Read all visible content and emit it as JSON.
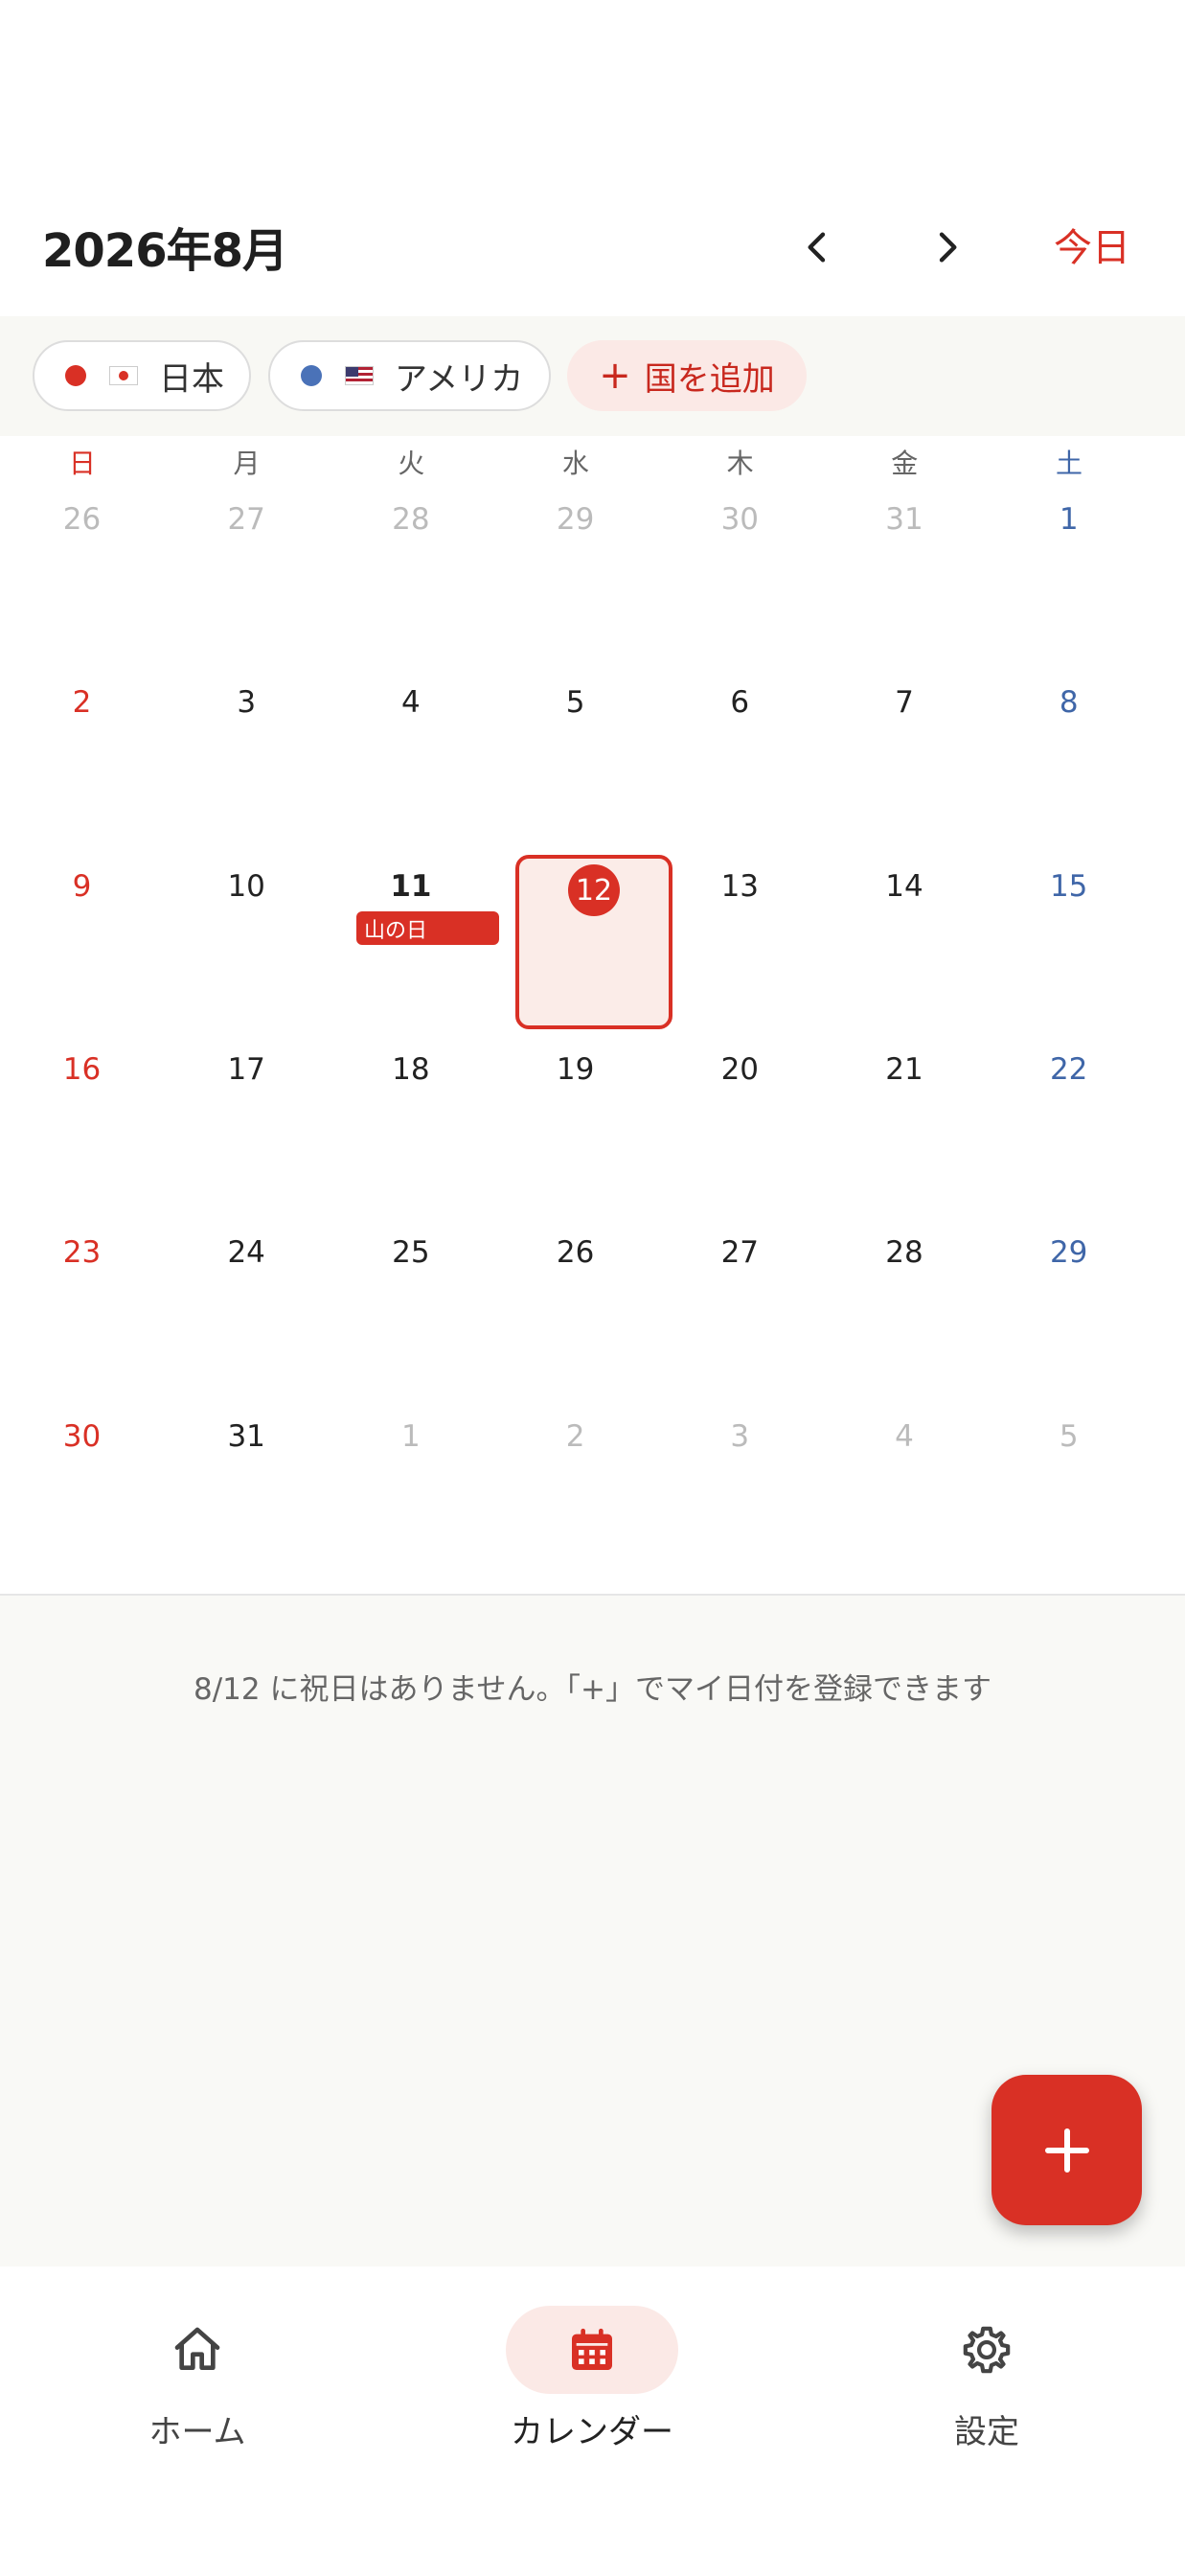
{
  "header": {
    "month_title": "2026年8月",
    "today_label": "今日"
  },
  "filters": {
    "chips": [
      {
        "label": "日本",
        "dot_color": "#d93025",
        "flag": "jp-flag"
      },
      {
        "label": "アメリカ",
        "dot_color": "#4a72b8",
        "flag": "us-flag"
      }
    ],
    "add_label": "国を追加"
  },
  "weekdays": [
    "日",
    "月",
    "火",
    "水",
    "木",
    "金",
    "土"
  ],
  "weeks": [
    [
      {
        "d": "26",
        "m": true
      },
      {
        "d": "27",
        "m": true
      },
      {
        "d": "28",
        "m": true
      },
      {
        "d": "29",
        "m": true
      },
      {
        "d": "30",
        "m": true
      },
      {
        "d": "31",
        "m": true
      },
      {
        "d": "1",
        "m": false
      }
    ],
    [
      {
        "d": "2",
        "m": false
      },
      {
        "d": "3",
        "m": false
      },
      {
        "d": "4",
        "m": false
      },
      {
        "d": "5",
        "m": false
      },
      {
        "d": "6",
        "m": false
      },
      {
        "d": "7",
        "m": false
      },
      {
        "d": "8",
        "m": false
      }
    ],
    [
      {
        "d": "9",
        "m": false
      },
      {
        "d": "10",
        "m": false
      },
      {
        "d": "11",
        "m": false,
        "holiday": true
      },
      {
        "d": "12",
        "m": false,
        "selected": true
      },
      {
        "d": "13",
        "m": false
      },
      {
        "d": "14",
        "m": false
      },
      {
        "d": "15",
        "m": false
      }
    ],
    [
      {
        "d": "16",
        "m": false
      },
      {
        "d": "17",
        "m": false
      },
      {
        "d": "18",
        "m": false
      },
      {
        "d": "19",
        "m": false
      },
      {
        "d": "20",
        "m": false
      },
      {
        "d": "21",
        "m": false
      },
      {
        "d": "22",
        "m": false
      }
    ],
    [
      {
        "d": "23",
        "m": false
      },
      {
        "d": "24",
        "m": false
      },
      {
        "d": "25",
        "m": false
      },
      {
        "d": "26",
        "m": false
      },
      {
        "d": "27",
        "m": false
      },
      {
        "d": "28",
        "m": false
      },
      {
        "d": "29",
        "m": false
      }
    ],
    [
      {
        "d": "30",
        "m": false
      },
      {
        "d": "31",
        "m": false
      },
      {
        "d": "1",
        "m": true
      },
      {
        "d": "2",
        "m": true
      },
      {
        "d": "3",
        "m": true
      },
      {
        "d": "4",
        "m": true
      },
      {
        "d": "5",
        "m": true
      }
    ]
  ],
  "holiday_tag": "山の日",
  "selected_day": "12",
  "info_message": "8/12 に祝日はありません。「+」でマイ日付を登録できます",
  "bottom_nav": [
    {
      "label": "ホーム",
      "icon": "home-icon",
      "active": false
    },
    {
      "label": "カレンダー",
      "icon": "calendar-icon",
      "active": true
    },
    {
      "label": "設定",
      "icon": "gear-icon",
      "active": false
    }
  ],
  "colors": {
    "accent": "#d93025",
    "saturday": "#3f66a8",
    "muted": "#bbbbbb"
  }
}
